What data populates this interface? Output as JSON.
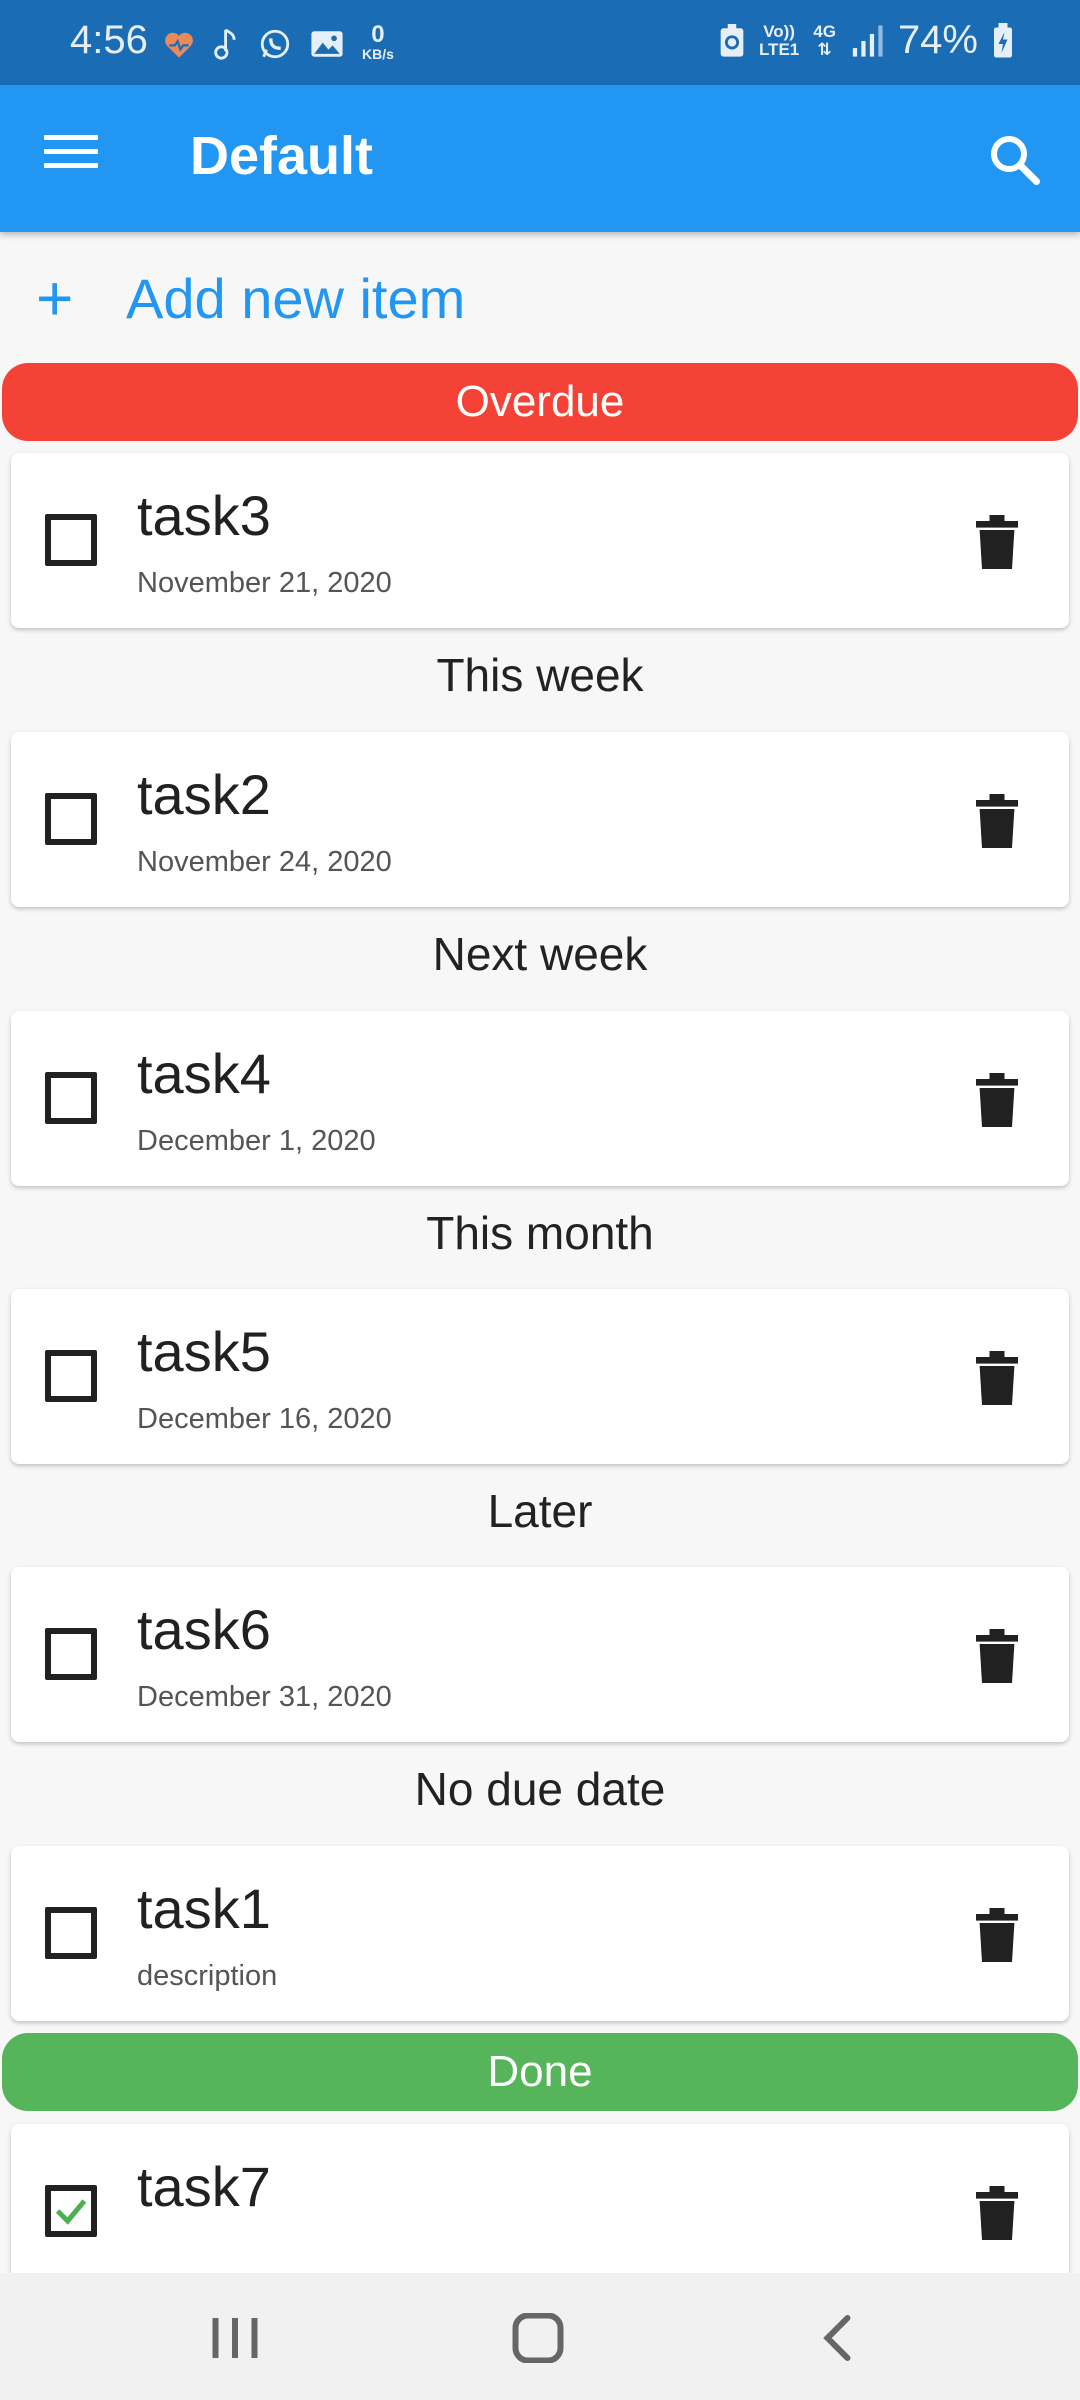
{
  "status_bar": {
    "time": "4:56",
    "net_speed_value": "0",
    "net_speed_unit": "KB/s",
    "volte": "Vo))",
    "lte": "LTE1",
    "network": "4G",
    "battery": "74%"
  },
  "app_bar": {
    "title": "Default",
    "menu_icon": "menu-icon",
    "search_icon": "search-icon"
  },
  "add_item": {
    "label": "Add new item",
    "icon": "plus-icon"
  },
  "sections": {
    "overdue": "Overdue",
    "this_week": "This week",
    "next_week": "Next week",
    "this_month": "This month",
    "later": "Later",
    "no_due_date": "No due date",
    "done": "Done"
  },
  "tasks": [
    {
      "name": "task3",
      "subtitle": "November 21, 2020",
      "checked": false
    },
    {
      "name": "task2",
      "subtitle": "November 24, 2020",
      "checked": false
    },
    {
      "name": "task4",
      "subtitle": "December 1, 2020",
      "checked": false
    },
    {
      "name": "task5",
      "subtitle": "December 16, 2020",
      "checked": false
    },
    {
      "name": "task6",
      "subtitle": "December 31, 2020",
      "checked": false
    },
    {
      "name": "task1",
      "subtitle": "description",
      "checked": false
    },
    {
      "name": "task7",
      "subtitle": "",
      "checked": true
    }
  ],
  "colors": {
    "primary": "#2196f3",
    "status_bar": "#1a6db5",
    "overdue": "#f44336",
    "done": "#56b55a",
    "check_green": "#4caf50"
  },
  "nav": {
    "recents_icon": "recents-icon",
    "home_icon": "home-icon",
    "back_icon": "back-icon"
  }
}
